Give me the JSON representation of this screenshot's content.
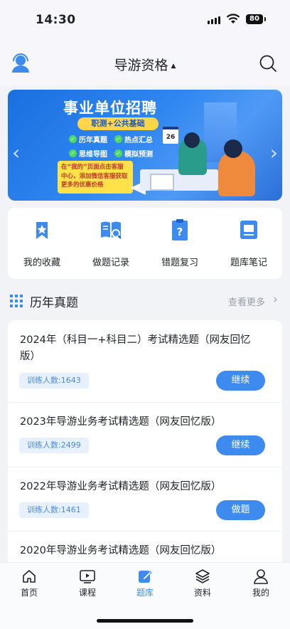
{
  "status_bar": {
    "time": "14:30",
    "battery": "80"
  },
  "header": {
    "title": "导游资格"
  },
  "banner": {
    "title": "事业单位招聘",
    "subtitle": "职测+公共基础",
    "features": [
      "历年真题",
      "热点汇总",
      "思维导图",
      "模拟预测"
    ],
    "note": "在“我的”页面点击客服中心，添加微信客服获取更多的优惠价格",
    "calendar_day": "26"
  },
  "quick_actions": [
    {
      "label": "我的收藏",
      "icon": "star-bookmark-icon"
    },
    {
      "label": "做题记录",
      "icon": "book-search-icon"
    },
    {
      "label": "错题复习",
      "icon": "question-clipboard-icon"
    },
    {
      "label": "题库笔记",
      "icon": "note-icon"
    }
  ],
  "section": {
    "title": "历年真题",
    "more": "查看更多"
  },
  "exams": [
    {
      "title": "2024年（科目一+科目二）考试精选题（网友回忆版）",
      "count": "训练人数:1643",
      "action": "继续"
    },
    {
      "title": "2023年导游业务考试精选题（网友回忆版）",
      "count": "训练人数:2499",
      "action": "继续"
    },
    {
      "title": "2022年导游业务考试精选题（网友回忆版）",
      "count": "训练人数:1461",
      "action": "做题"
    },
    {
      "title": "2020年导游业务考试精选题（网友回忆版）"
    }
  ],
  "bottom_nav": [
    {
      "label": "首页",
      "icon": "home-icon"
    },
    {
      "label": "课程",
      "icon": "video-icon"
    },
    {
      "label": "题库",
      "icon": "edit-icon",
      "active": true
    },
    {
      "label": "资料",
      "icon": "layers-icon"
    },
    {
      "label": "我的",
      "icon": "user-icon"
    }
  ],
  "colors": {
    "accent": "#3d8bef",
    "badge_bg": "#e6f0ff",
    "banner_blue": "#2f86f0"
  }
}
